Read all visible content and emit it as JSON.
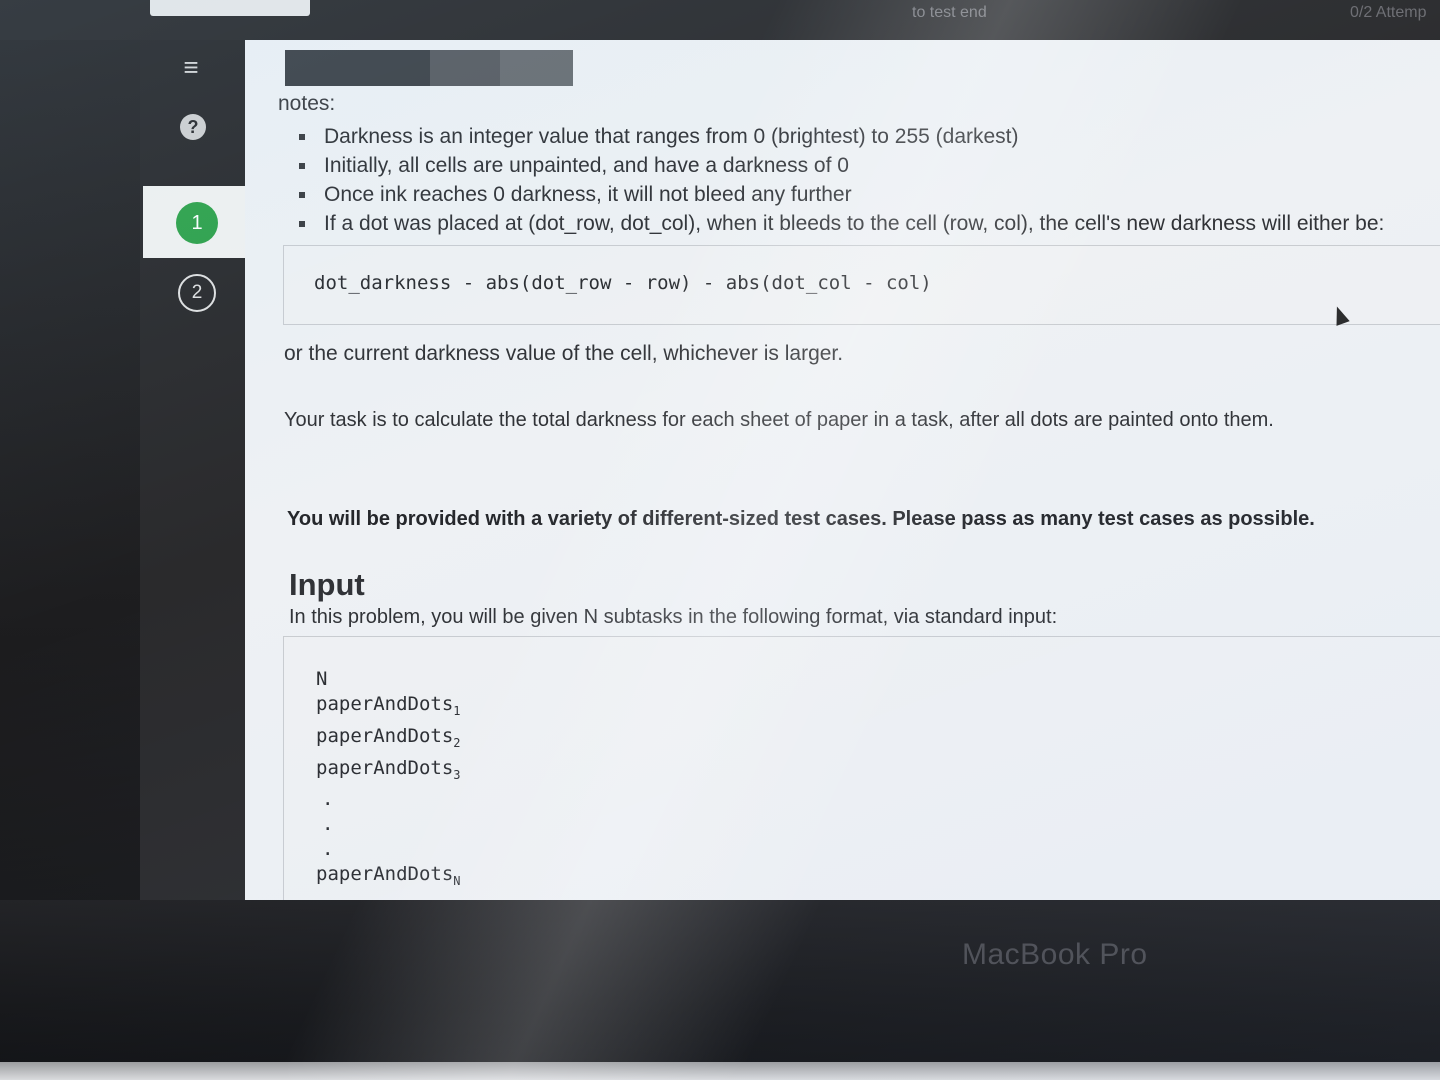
{
  "topbar": {
    "center_text": "to test end",
    "right_text": "0/2 Attemp"
  },
  "sidebar": {
    "icons": [
      "list-icon",
      "help-icon"
    ],
    "steps": [
      {
        "number": "1",
        "state": "active",
        "color": "#2fa24a"
      },
      {
        "number": "2",
        "state": "inactive"
      }
    ]
  },
  "content": {
    "notes_label": "notes:",
    "notes": [
      "Darkness is an integer value that ranges from 0 (brightest) to 255 (darkest)",
      "Initially, all cells are unpainted, and have a darkness of 0",
      "Once ink reaches 0 darkness, it will not bleed any further",
      "If a dot was placed at (dot_row, dot_col), when it bleeds to the cell (row, col), the cell's new darkness will either be:"
    ],
    "formula": "dot_darkness - abs(dot_row - row) - abs(dot_col - col)",
    "or_text": "or the current darkness value of the cell, whichever is larger.",
    "task_text": "Your task is to calculate the total darkness for each sheet of paper in a task, after all dots are painted onto them.",
    "bold_text": "You will be provided with a variety of different-sized test cases. Please pass as many test cases as possible.",
    "input_heading": "Input",
    "input_intro": "In this problem, you will be given N subtasks in the following format, via standard input:",
    "input_format": {
      "first_line": "N",
      "lines": [
        {
          "base": "paperAndDots",
          "sub": "1"
        },
        {
          "base": "paperAndDots",
          "sub": "2"
        },
        {
          "base": "paperAndDots",
          "sub": "3"
        }
      ],
      "dots": [
        ".",
        ".",
        "."
      ],
      "last_line": {
        "base": "paperAndDots",
        "sub": "N"
      }
    }
  },
  "device": {
    "label": "MacBook Pro"
  }
}
